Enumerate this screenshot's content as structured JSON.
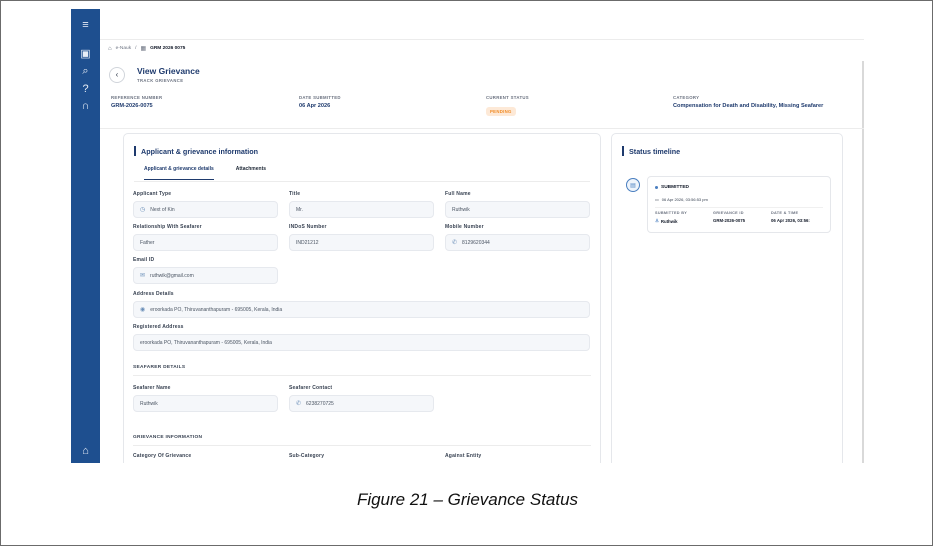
{
  "breadcrumb": {
    "home": "e-Nauk",
    "separator": "/",
    "current": "GRM 2026 0075"
  },
  "page": {
    "title": "View Grievance",
    "subtitle": "TRACK GRIEVANCE"
  },
  "summary": {
    "reference_label": "REFERENCE NUMBER",
    "reference_value": "GRM-2026-0075",
    "date_label": "DATE SUBMITTED",
    "date_value": "06 Apr 2026",
    "status_label": "CURRENT STATUS",
    "status_value": "PENDING",
    "category_label": "CATEGORY",
    "category_value": "Compensation for Death and Disability, Missing Seafarer"
  },
  "main_card": {
    "heading": "Applicant & grievance information",
    "tabs": [
      "Applicant & grievance details",
      "Attachments"
    ],
    "fields": {
      "applicant_type": {
        "label": "Applicant Type",
        "value": "Next of Kin"
      },
      "title": {
        "label": "Title",
        "value": "Mr."
      },
      "full_name": {
        "label": "Full Name",
        "value": "Ruthwik"
      },
      "relationship": {
        "label": "Relationship With Seafarer",
        "value": "Father"
      },
      "indos": {
        "label": "INDoS Number",
        "value": "IND21212"
      },
      "mobile": {
        "label": "Mobile Number",
        "value": "8129620344"
      },
      "email": {
        "label": "Email ID",
        "value": "ruthwik@gmail.com"
      },
      "address": {
        "label": "Address Details",
        "value": "eroorkada PO, Thiruvananthapuram - 695005, Kerala, India"
      },
      "registered_address": {
        "label": "Registered Address",
        "value": "eroorkada PO, Thiruvananthapuram - 695005, Kerala, India"
      }
    },
    "seafarer_section": "SEAFARER DETAILS",
    "seafarer": {
      "name": {
        "label": "Seafarer Name",
        "value": "Ruthwik"
      },
      "contact": {
        "label": "Seafarer Contact",
        "value": "6238270725"
      }
    },
    "grievance_section": "GRIEVANCE INFORMATION",
    "grievance_labels": {
      "category": "Category Of Grievance",
      "sub_category": "Sub-Category",
      "against": "Against Entity"
    }
  },
  "timeline": {
    "heading": "Status timeline",
    "status": "SUBMITTED",
    "datetime": "06 Apr 2026, 03:56:53 pm",
    "submitted_by_label": "SUBMITTED BY",
    "submitted_by_value": "Ruthwik",
    "grievance_id_label": "GRIEVANCE ID",
    "grievance_id_value": "GRM-2026-0075",
    "date_time_label": "DATE & TIME",
    "date_time_value": "06 Apr 2026, 03:56:"
  },
  "caption": "Figure 21 – Grievance  Status"
}
